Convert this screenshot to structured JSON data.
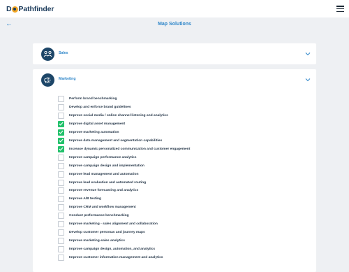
{
  "app": {
    "logo_left": "D",
    "logo_right": "Pathfinder",
    "title": "Map Solutions"
  },
  "categories": [
    {
      "label": "Sales",
      "icon": "handshake-icon",
      "expanded": false
    },
    {
      "label": "Marketing",
      "icon": "megaphone-icon",
      "expanded": true
    }
  ],
  "marketing_items": [
    {
      "label": "Perform brand benchmarking",
      "checked": false
    },
    {
      "label": "Develop and enforce brand guidelines",
      "checked": false
    },
    {
      "label": "Improve social media / online channel listening and analytics",
      "checked": false
    },
    {
      "label": "Improve digital asset management",
      "checked": true
    },
    {
      "label": "Improve marketing automation",
      "checked": true
    },
    {
      "label": "Improve data management and segmentation capabilities",
      "checked": true
    },
    {
      "label": "Increase dynamic personalized communication and customer engagement",
      "checked": true
    },
    {
      "label": "Improve campaign performance analytics",
      "checked": false
    },
    {
      "label": "Improve campaign design and implementation",
      "checked": false
    },
    {
      "label": "Improve lead management and automation",
      "checked": false
    },
    {
      "label": "Improve lead evaluation and automated routing",
      "checked": false
    },
    {
      "label": "Improve revenue forecasting and analytics",
      "checked": false
    },
    {
      "label": "Improve A/B testing",
      "checked": false
    },
    {
      "label": "Improve CRM and workflow management",
      "checked": false
    },
    {
      "label": "Conduct performance benchmarking",
      "checked": false
    },
    {
      "label": "Improve marketing - sales alignment and collaboration",
      "checked": false
    },
    {
      "label": "Develop customer personas and journey maps",
      "checked": false
    },
    {
      "label": "Improve marketing-sales analytics",
      "checked": false
    },
    {
      "label": "Improve campaign design, automation, and analytics",
      "checked": false
    },
    {
      "label": "Improve customer information management and analytics",
      "checked": false
    }
  ],
  "colors": {
    "accent": "#2e86c9",
    "navy": "#1d4668",
    "check": "#22c16b",
    "logo_mark": "#f2a623"
  }
}
